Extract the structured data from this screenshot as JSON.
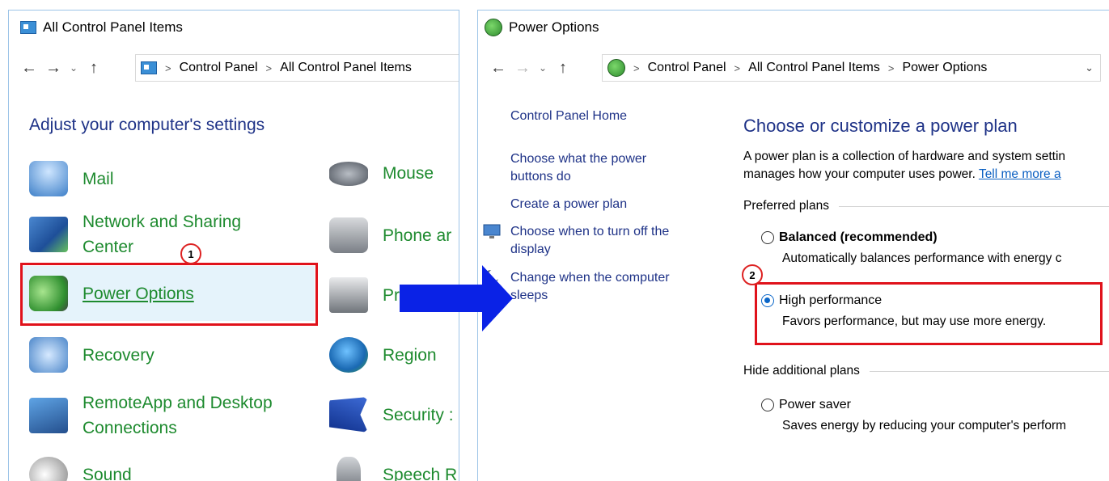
{
  "left_window": {
    "title": "All Control Panel Items",
    "breadcrumb": [
      "Control Panel",
      "All Control Panel Items"
    ],
    "heading": "Adjust your computer's settings",
    "items_col1": [
      {
        "label": "Mail",
        "icon": "mail-icon"
      },
      {
        "label": "Network and Sharing Center",
        "line1": "Network and Sharing",
        "line2": "Center",
        "icon": "network-icon"
      },
      {
        "label": "Power Options",
        "icon": "power-options-icon"
      },
      {
        "label": "Recovery",
        "icon": "recovery-icon"
      },
      {
        "label": "RemoteApp and Desktop Connections",
        "line1": "RemoteApp and Desktop",
        "line2": "Connections",
        "icon": "remoteapp-icon"
      },
      {
        "label": "Sound",
        "icon": "sound-icon"
      }
    ],
    "items_col2": [
      {
        "label": "Mouse",
        "icon": "mouse-icon"
      },
      {
        "label": "Phone ar",
        "icon": "phone-icon"
      },
      {
        "label": "Programs",
        "icon": "programs-icon"
      },
      {
        "label": "Region",
        "icon": "region-icon"
      },
      {
        "label": "Security :",
        "icon": "security-icon"
      },
      {
        "label": "Speech R",
        "icon": "speech-icon"
      }
    ],
    "step_badge": "1"
  },
  "right_window": {
    "title": "Power Options",
    "breadcrumb": [
      "Control Panel",
      "All Control Panel Items",
      "Power Options"
    ],
    "sidebar": {
      "home": "Control Panel Home",
      "links": [
        {
          "line1": "Choose what the power",
          "line2": "buttons do"
        },
        {
          "line1": "Create a power plan",
          "line2": ""
        },
        {
          "line1": "Choose when to turn off the",
          "line2": "display",
          "icon": "monitor-icon"
        },
        {
          "line1": "Change when the computer",
          "line2": "sleeps",
          "icon": "moon-icon"
        }
      ]
    },
    "heading": "Choose or customize a power plan",
    "description_line1": "A power plan is a collection of hardware and system settin",
    "description_line2": "manages how your computer uses power. ",
    "description_link": "Tell me more a",
    "preferred_plans_label": "Preferred plans",
    "hide_plans_label": "Hide additional plans",
    "plans": [
      {
        "name": "Balanced (recommended)",
        "description": "Automatically balances performance with energy c",
        "selected": false
      },
      {
        "name": "High performance",
        "description": "Favors performance, but may use more energy.",
        "selected": true
      },
      {
        "name": "Power saver",
        "description": "Saves energy by reducing your computer's perform",
        "selected": false
      }
    ],
    "step_badge": "2"
  },
  "colors": {
    "link_blue": "#1e3287",
    "item_green": "#1d8a2e",
    "highlight_red": "#e0121b",
    "arrow_blue": "#0a22e6"
  }
}
